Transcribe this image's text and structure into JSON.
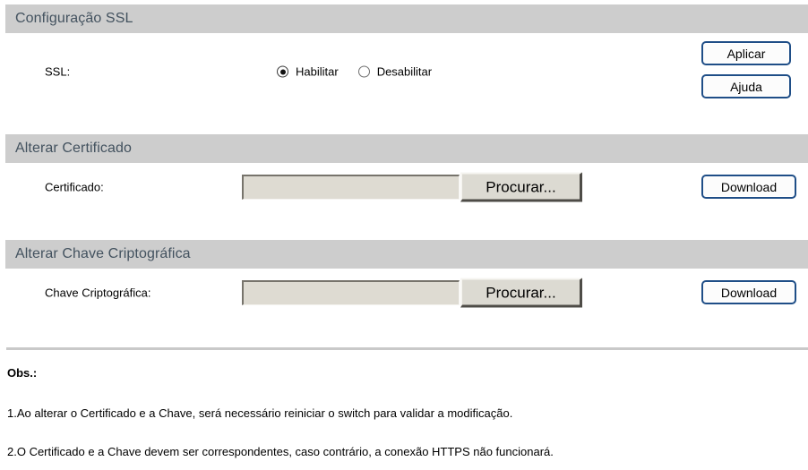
{
  "sections": [
    {
      "title": "Configuração SSL",
      "label": "SSL:",
      "radios": [
        {
          "label": "Habilitar",
          "checked": true
        },
        {
          "label": "Desabilitar",
          "checked": false
        }
      ],
      "buttons": [
        {
          "label": "Aplicar"
        },
        {
          "label": "Ajuda"
        }
      ]
    },
    {
      "title": "Alterar Certificado",
      "label": "Certificado:",
      "input_value": "",
      "input_placeholder": "",
      "browse_label": "Procurar...",
      "download_label": "Download"
    },
    {
      "title": "Alterar Chave Criptográfica",
      "label": "Chave Criptográfica:",
      "input_value": "",
      "input_placeholder": "",
      "browse_label": "Procurar...",
      "download_label": "Download"
    }
  ],
  "notes": {
    "heading": "Obs.:",
    "items": [
      "1.Ao alterar o Certificado e a Chave, será necessário reiniciar o switch para validar a modificação.",
      "2.O Certificado e a Chave devem ser correspondentes, caso contrário, a conexão HTTPS não funcionará."
    ]
  },
  "colors": {
    "section_bar": "#cdcdcd",
    "section_title": "#43525f",
    "button_border_blue": "#1f4e87",
    "input_face": "#dedbd2",
    "button_face": "#dcdad2",
    "divider": "#c9c9c9"
  }
}
